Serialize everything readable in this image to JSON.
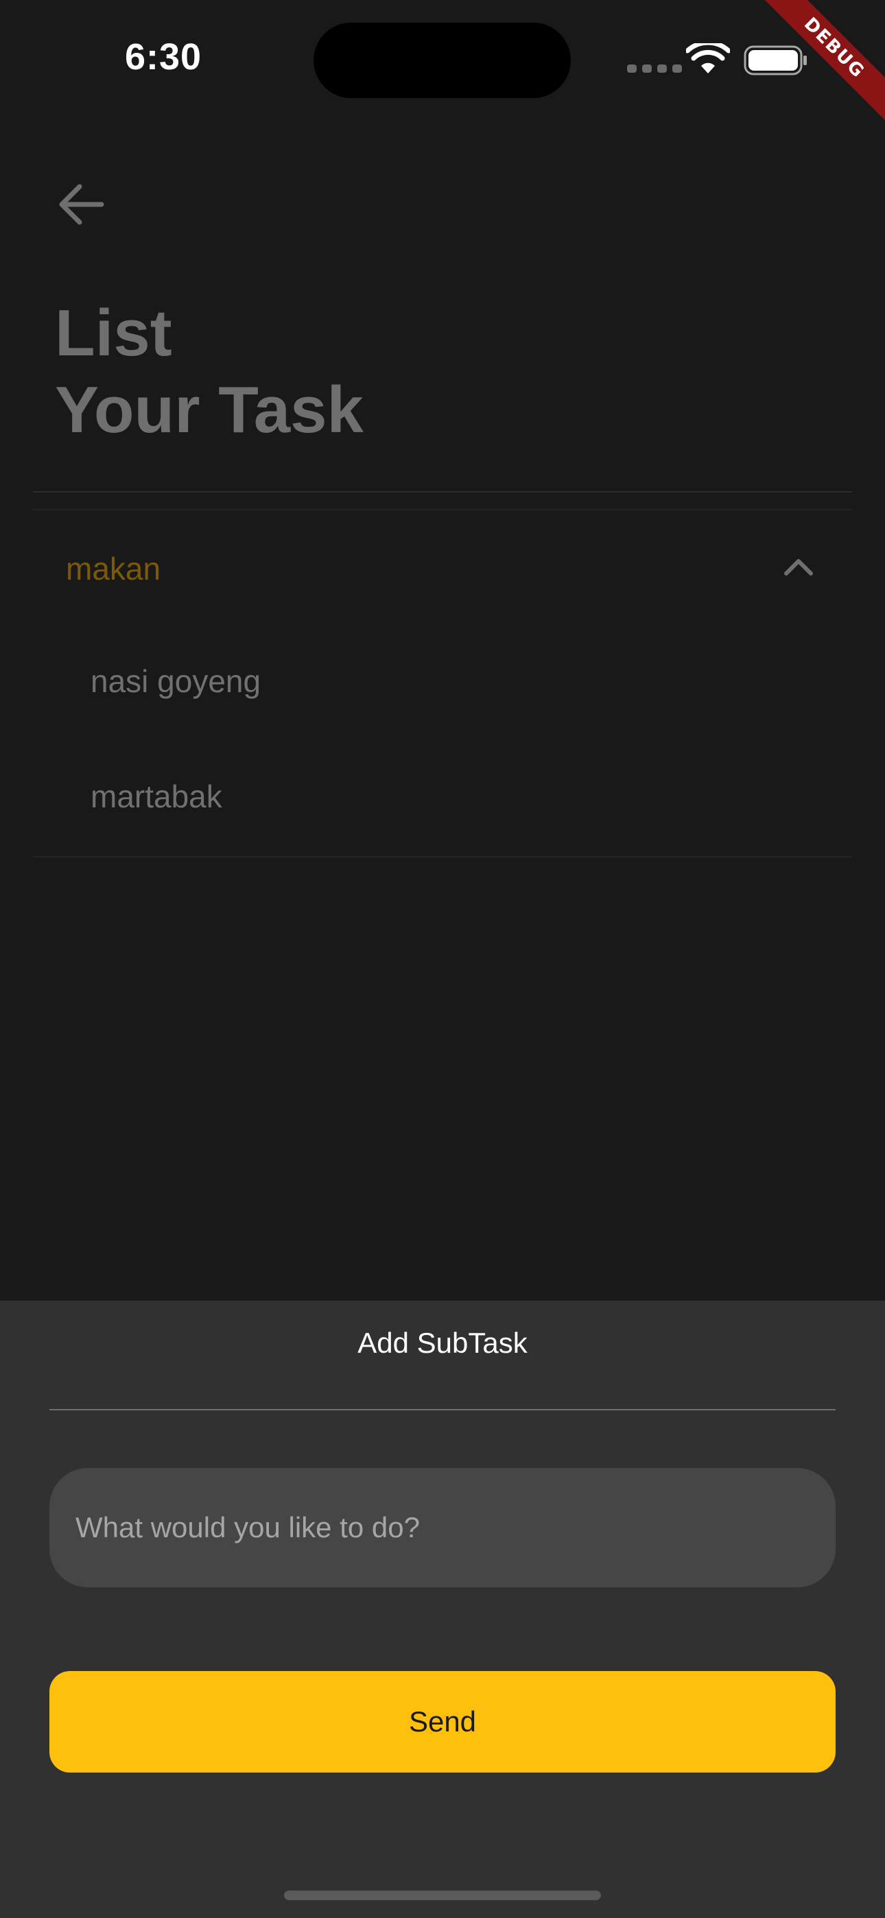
{
  "status_bar": {
    "time": "6:30"
  },
  "debug_banner": "DEBUG",
  "header": {
    "back_icon": "arrow-left-icon",
    "title_line1": "List",
    "title_line2": "Your Task"
  },
  "task_group": {
    "label": "makan",
    "expanded": true,
    "toggle_icon": "chevron-up-icon",
    "subtasks": [
      {
        "label": "nasi goyeng"
      },
      {
        "label": "martabak"
      }
    ]
  },
  "sheet": {
    "title": "Add SubTask",
    "input_value": "",
    "input_placeholder": "What would you like to do?",
    "send_label": "Send"
  },
  "colors": {
    "accent": "#FEC00D",
    "group_label": "#7A5A09",
    "background": "#191919",
    "sheet_background": "#313131"
  }
}
